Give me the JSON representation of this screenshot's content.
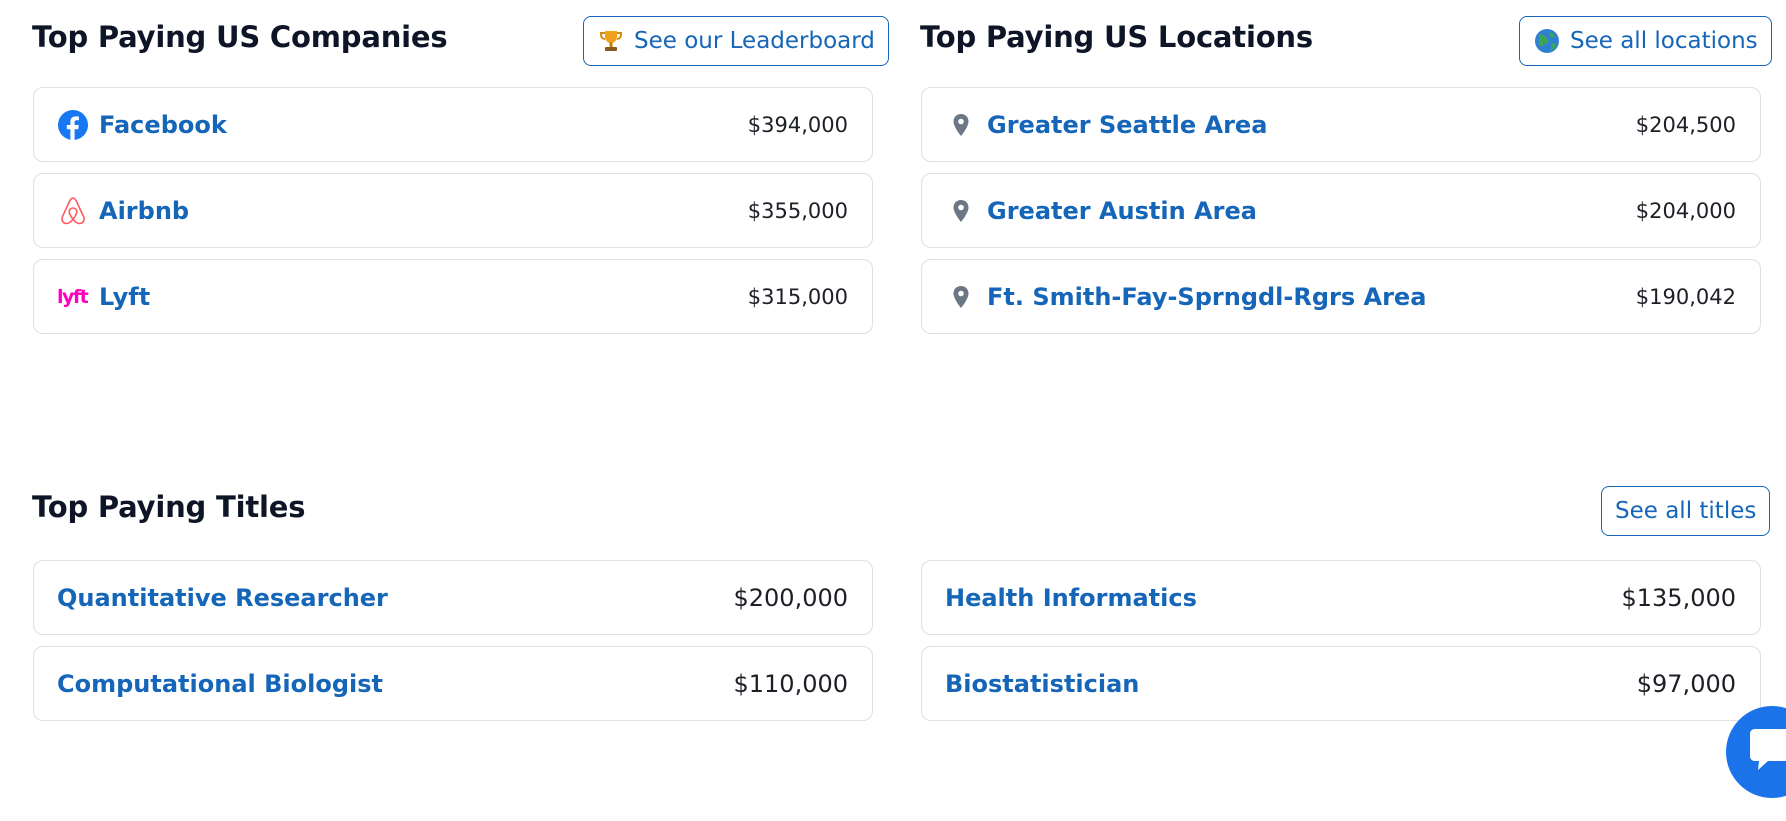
{
  "companies": {
    "heading": "Top Paying US Companies",
    "button_label": "See our Leaderboard",
    "button_icon": "trophy-icon",
    "items": [
      {
        "name": "Facebook",
        "value": "$394,000",
        "icon": "facebook-logo-icon"
      },
      {
        "name": "Airbnb",
        "value": "$355,000",
        "icon": "airbnb-logo-icon"
      },
      {
        "name": "Lyft",
        "value": "$315,000",
        "icon": "lyft-logo-icon"
      }
    ]
  },
  "locations": {
    "heading": "Top Paying US Locations",
    "button_label": "See all locations",
    "button_icon": "globe-icon",
    "items": [
      {
        "name": "Greater Seattle Area",
        "value": "$204,500",
        "icon": "map-pin-icon"
      },
      {
        "name": "Greater Austin Area",
        "value": "$204,000",
        "icon": "map-pin-icon"
      },
      {
        "name": "Ft. Smith-Fay-Sprngdl-Rgrs Area",
        "value": "$190,042",
        "icon": "map-pin-icon"
      }
    ]
  },
  "titles": {
    "heading": "Top Paying Titles",
    "button_label": "See all titles",
    "items": [
      {
        "name": "Quantitative Researcher",
        "value": "$200,000"
      },
      {
        "name": "Health Informatics",
        "value": "$135,000"
      },
      {
        "name": "Computational Biologist",
        "value": "$110,000"
      },
      {
        "name": "Biostatistician",
        "value": "$97,000"
      }
    ]
  },
  "chat": {
    "icon": "chat-icon"
  },
  "colors": {
    "link": "#1565b8",
    "heading": "#0d1526",
    "card_border": "#dcdfe4",
    "facebook": "#1877f2",
    "airbnb": "#ff5a5f",
    "lyft": "#ff00bf",
    "pin": "#6b7785",
    "chat": "#1a73e8"
  }
}
